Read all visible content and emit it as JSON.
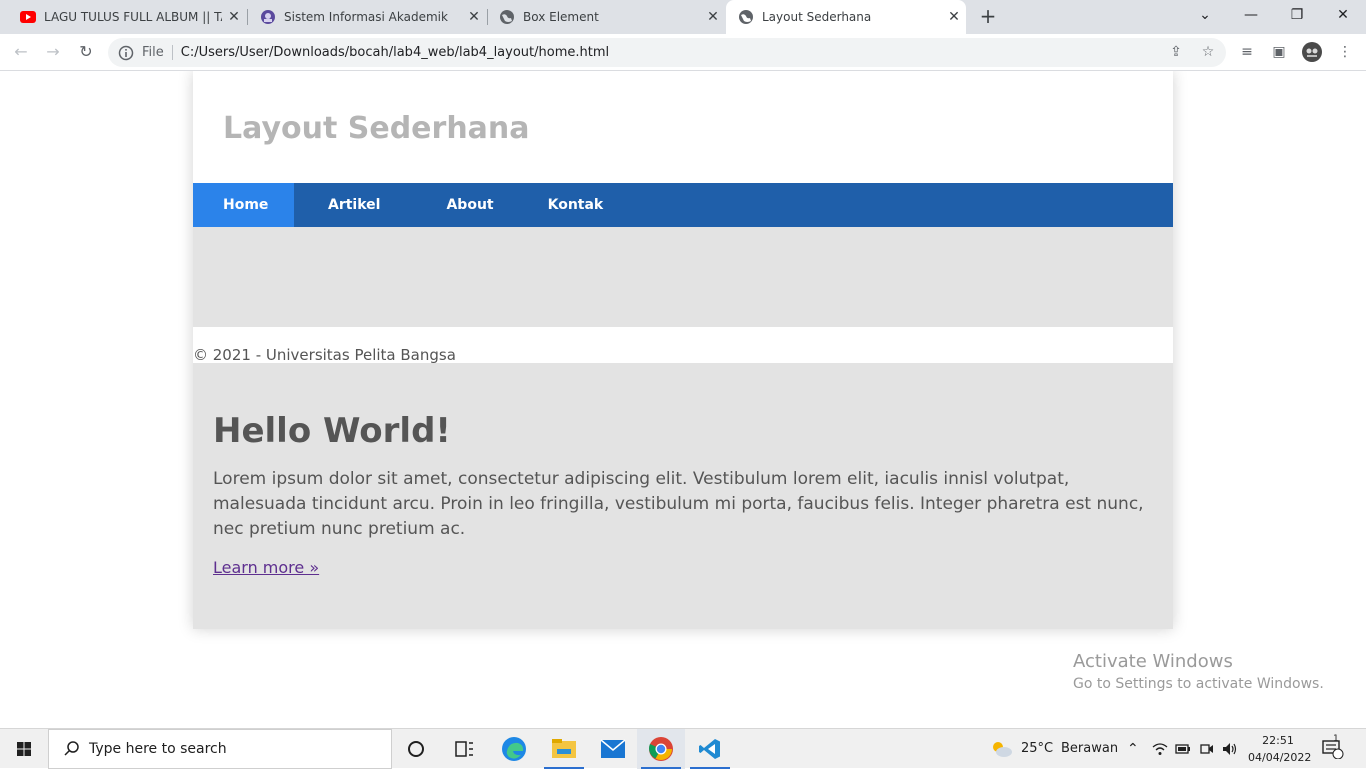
{
  "browser": {
    "tabs": [
      {
        "title": "LAGU TULUS FULL ALBUM || TAN",
        "icon": "youtube-icon"
      },
      {
        "title": "Sistem Informasi Akademik",
        "icon": "campus-logo-icon"
      },
      {
        "title": "Box Element",
        "icon": "globe-icon"
      },
      {
        "title": "Layout Sederhana",
        "icon": "globe-icon",
        "active": true
      }
    ],
    "address": {
      "scheme": "File",
      "url": "C:/Users/User/Downloads/bocah/lab4_web/lab4_layout/home.html"
    }
  },
  "page": {
    "site_title": "Layout Sederhana",
    "nav": [
      "Home",
      "Artikel",
      "About",
      "Kontak"
    ],
    "active_nav": "Home",
    "footer": "© 2021 - Universitas Pelita Bangsa",
    "hero": {
      "heading": "Hello World!",
      "body": "Lorem ipsum dolor sit amet, consectetur adipiscing elit. Vestibulum lorem elit, iaculis innisl volutpat, malesuada tincidunt arcu. Proin in leo fringilla, vestibulum mi porta, faucibus felis. Integer pharetra est nunc, nec pretium nunc pretium ac.",
      "link": "Learn more »"
    },
    "watermark": {
      "title": "Activate Windows",
      "subtitle": "Go to Settings to activate Windows."
    }
  },
  "taskbar": {
    "search_placeholder": "Type here to search",
    "weather": "25°C",
    "weather_desc": "Berawan",
    "time": "22:51",
    "date": "04/04/2022",
    "notifications": "1"
  },
  "colors": {
    "nav_bg": "#1f5faa",
    "nav_active": "#2b83ea",
    "content_bg": "#e3e3e3",
    "title_gray": "#b5b5b5"
  }
}
